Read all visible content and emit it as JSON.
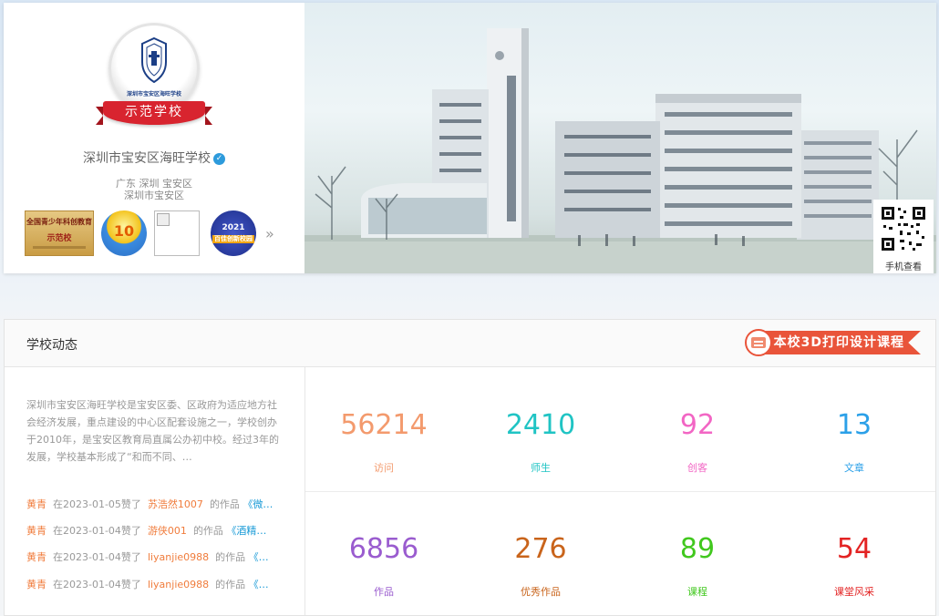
{
  "school": {
    "name": "深圳市宝安区海旺学校",
    "badge_ribbon": "示范学校",
    "badge_small_name": "深圳市宝安区海旺学校",
    "location_line1": "广东 深圳 宝安区",
    "location_line2": "深圳市宝安区",
    "verified_icon": "check-icon"
  },
  "honors": {
    "honor1_title": "全国青少年科创教育",
    "honor1_sub": "示范校",
    "honor2_text": "10",
    "honor4_year": "2021",
    "honor4_name": "百佳创新校园",
    "more": "»"
  },
  "qr": {
    "label": "手机查看"
  },
  "news": {
    "title": "学校动态",
    "banner": "本校3D打印设计课程",
    "intro": "深圳市宝安区海旺学校是宝安区委、区政府为适应地方社会经济发展，重点建设的中心区配套设施之一，学校创办于2010年，是宝安区教育局直属公办初中校。经过3年的发展，学校基本形成了“和而不同、…",
    "activities": [
      {
        "user": "黄青",
        "mid": "在2023-01-05赞了",
        "target": "苏浩然1007",
        "of": "的作品",
        "work": "《微…"
      },
      {
        "user": "黄青",
        "mid": "在2023-01-04赞了",
        "target": "游侠001",
        "of": "的作品",
        "work": "《酒精…"
      },
      {
        "user": "黄青",
        "mid": "在2023-01-04赞了",
        "target": "liyanjie0988",
        "of": "的作品",
        "work": "《…"
      },
      {
        "user": "黄青",
        "mid": "在2023-01-04赞了",
        "target": "liyanjie0988",
        "of": "的作品",
        "work": "《…"
      }
    ]
  },
  "stats": [
    {
      "value": "56214",
      "label": "访问",
      "color": "#f39a6d"
    },
    {
      "value": "2410",
      "label": "师生",
      "color": "#20c4c4"
    },
    {
      "value": "92",
      "label": "创客",
      "color": "#f266c4"
    },
    {
      "value": "13",
      "label": "文章",
      "color": "#2ba0e8"
    },
    {
      "value": "6856",
      "label": "作品",
      "color": "#9a5ccf"
    },
    {
      "value": "276",
      "label": "优秀作品",
      "color": "#c9641b"
    },
    {
      "value": "89",
      "label": "课程",
      "color": "#41c81e"
    },
    {
      "value": "54",
      "label": "课堂风采",
      "color": "#e32323"
    }
  ]
}
